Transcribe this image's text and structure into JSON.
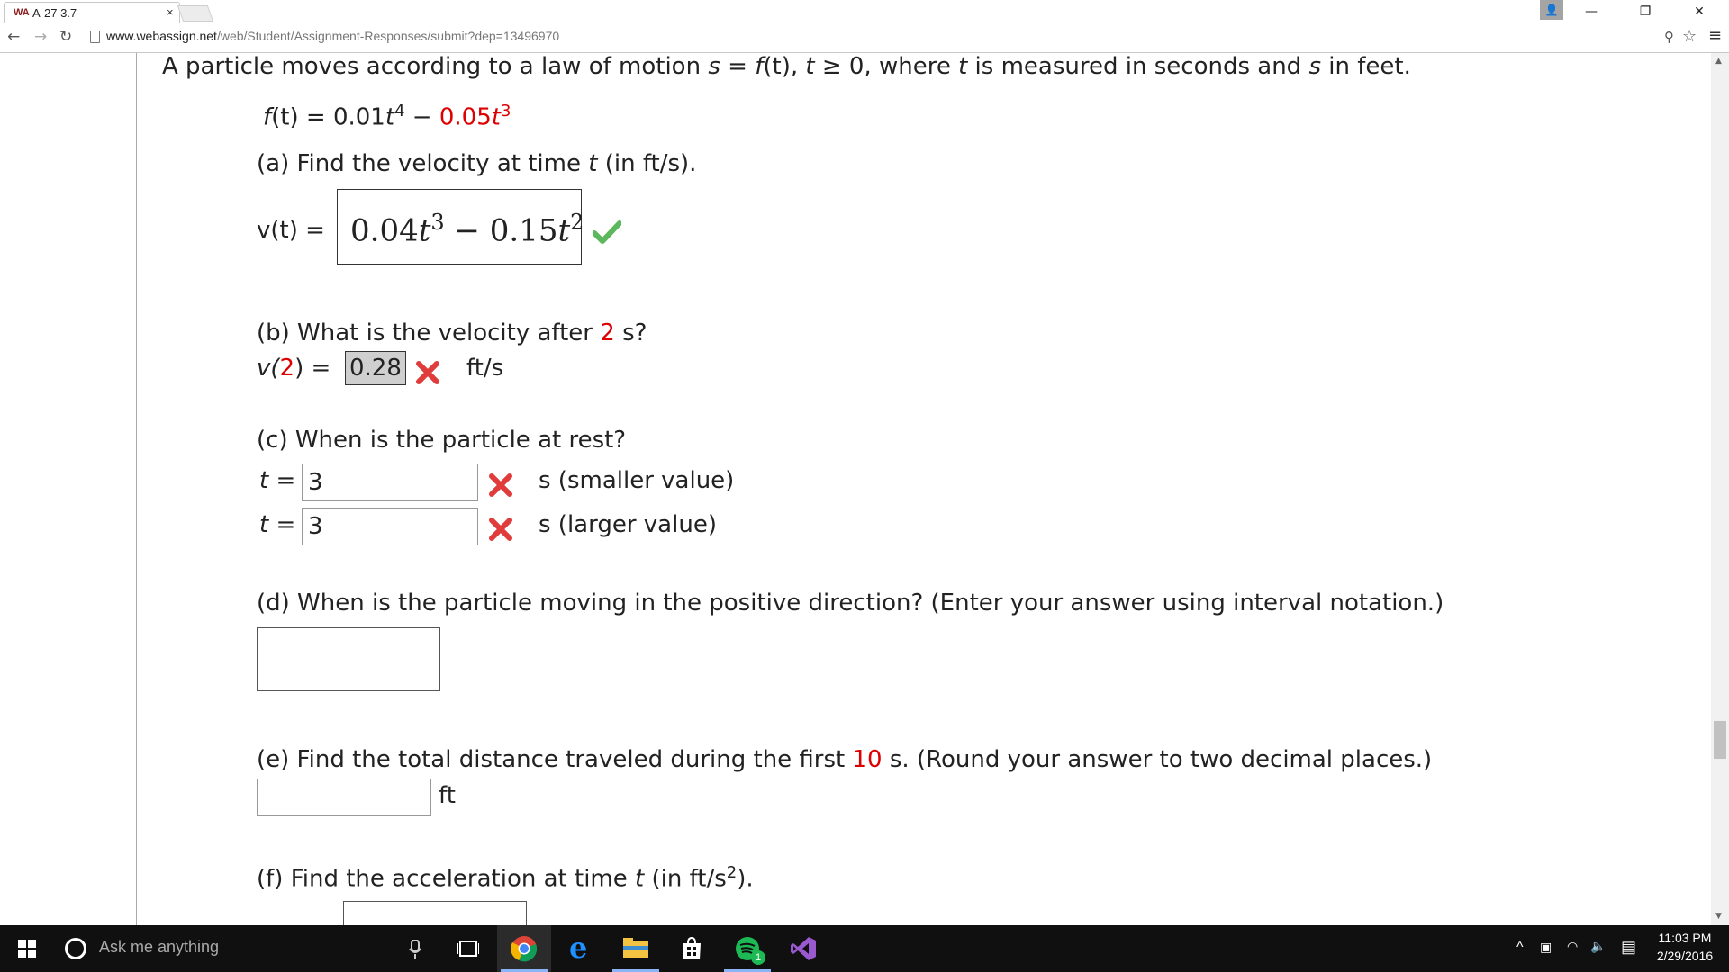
{
  "browser": {
    "tab_title": "A-27 3.7",
    "tab_favicon": "WA",
    "tab_close": "×",
    "url_host": "www.webassign.net",
    "url_path": "/web/Student/Assignment-Responses/submit?dep=13496970"
  },
  "problem": {
    "intro_a": "A particle moves according to a law of motion ",
    "intro_s": "s",
    "intro_eq": " = ",
    "intro_ft": "f",
    "intro_t_paren": "(t)",
    "intro_comma": ", ",
    "intro_t": "t",
    "intro_ge": " ≥ 0, where ",
    "intro_t2": "t",
    "intro_mid": " is measured in seconds and ",
    "intro_s2": "s",
    "intro_end": " in feet.",
    "function_lhs": "f",
    "function_lhs_arg": "(t)",
    "function_eq": " = 0.01",
    "function_t1": "t",
    "function_exp1": "4",
    "function_minus": " − ",
    "function_coef2": "0.05",
    "function_t2": "t",
    "function_exp2": "3"
  },
  "part_a": {
    "question_prefix": "(a) Find the velocity at time ",
    "question_t": "t",
    "question_suffix": " (in ft/s).",
    "lhs": "v(t)  =",
    "answer_part1": "0.04",
    "answer_t1": "t",
    "answer_exp1": "3",
    "answer_minus": " − 0.15",
    "answer_t2": "t",
    "answer_exp2": "2",
    "status": "correct"
  },
  "part_b": {
    "question_prefix": "(b) What is the velocity after ",
    "question_value": "2",
    "question_suffix": " s?",
    "lhs_v": "v(",
    "lhs_arg": "2",
    "lhs_close": ")  =",
    "answer": "0.28",
    "unit": "ft/s",
    "status": "incorrect"
  },
  "part_c": {
    "question": "(c) When is the particle at rest?",
    "rows": [
      {
        "lhs_t": "t",
        "lhs_eq": " =",
        "value": "3",
        "suffix": "s (smaller value)",
        "status": "incorrect"
      },
      {
        "lhs_t": "t",
        "lhs_eq": " =",
        "value": "3",
        "suffix": "s (larger value)",
        "status": "incorrect"
      }
    ]
  },
  "part_d": {
    "question": "(d) When is the particle moving in the positive direction? (Enter your answer using interval notation.)",
    "value": ""
  },
  "part_e": {
    "question_prefix": "(e) Find the total distance traveled during the first ",
    "question_value": "10",
    "question_suffix": " s. (Round your answer to two decimal places.)",
    "value": "",
    "unit": "ft"
  },
  "part_f": {
    "question_prefix": "(f) Find the acceleration at time ",
    "question_t": "t",
    "question_mid": " (in ft/s",
    "question_exp": "2",
    "question_suffix": ")."
  },
  "taskbar": {
    "search_placeholder": "Ask me anything",
    "time": "11:03 PM",
    "date": "2/29/2016",
    "apps": [
      "task-view-icon",
      "chrome-icon",
      "edge-icon",
      "file-explorer-icon",
      "store-icon",
      "spotify-icon",
      "visual-studio-icon"
    ],
    "spotify_badge": "1"
  },
  "colors": {
    "accent_red": "#dd0000",
    "check_green": "#5cb85c",
    "x_red": "#e03c3c"
  }
}
